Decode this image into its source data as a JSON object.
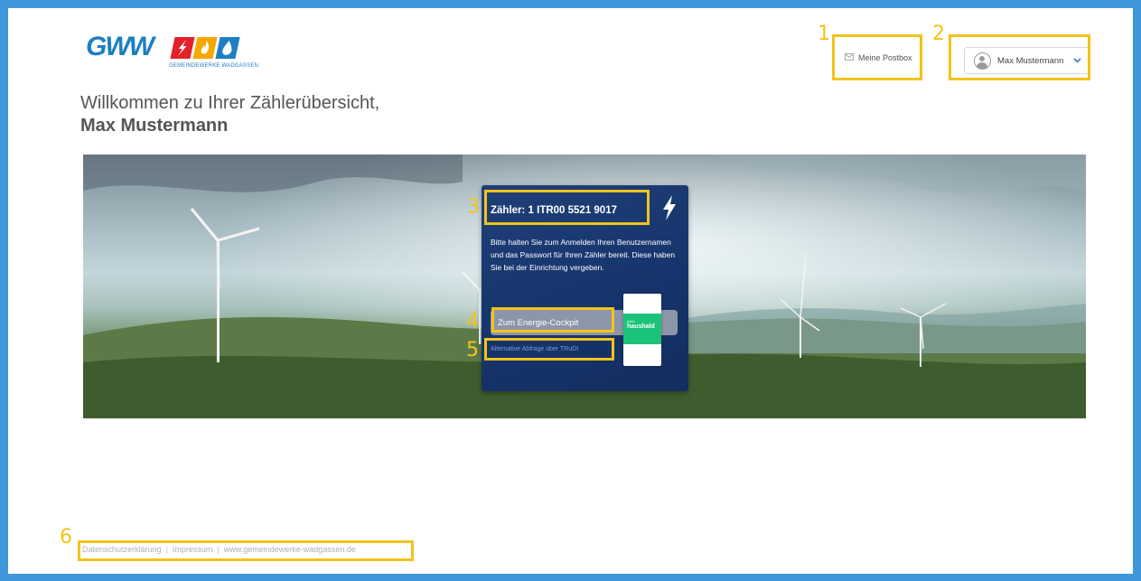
{
  "header": {
    "logo_text": "GWW",
    "logo_subtitle": "GEMEINDEWERKE WADGASSEN",
    "postbox_label": "Meine Postbox",
    "postbox_icon": "envelope-icon",
    "user_name": "Max Mustermann",
    "user_icon": "user-avatar-icon",
    "user_chevron": "chevron-down-icon"
  },
  "welcome": {
    "line1": "Willkommen zu Ihrer Zählerübersicht,",
    "line2": "Max Mustermann"
  },
  "meter_card": {
    "title": "Zähler: 1 ITR00 5521 9017",
    "icon": "lightning-icon",
    "description": "Bitte halten Sie zum Anmelden Ihren Benutzernamen und das Passwort für Ihren Zähler bereit. Diese haben Sie bei der Einrichtung vergeben.",
    "cockpit_button": "Zum Energie-Cockpit",
    "badge_small": "mein",
    "badge_big": "haushald",
    "alt_link": "Alternative Abfrage über TRuDI"
  },
  "footer": {
    "privacy": "Datenschutzerklärung",
    "imprint": "Impressum",
    "website": "www.gemeindewerke-wadgassen.de",
    "separator": "|"
  },
  "annotations": [
    "1",
    "2",
    "3",
    "4",
    "5",
    "6"
  ],
  "colors": {
    "frame": "#3f96d8",
    "brand_blue": "#1c7fc3",
    "highlight": "#f3c31a",
    "card_bg": "#1f3f78",
    "badge_green": "#1bc37a"
  }
}
